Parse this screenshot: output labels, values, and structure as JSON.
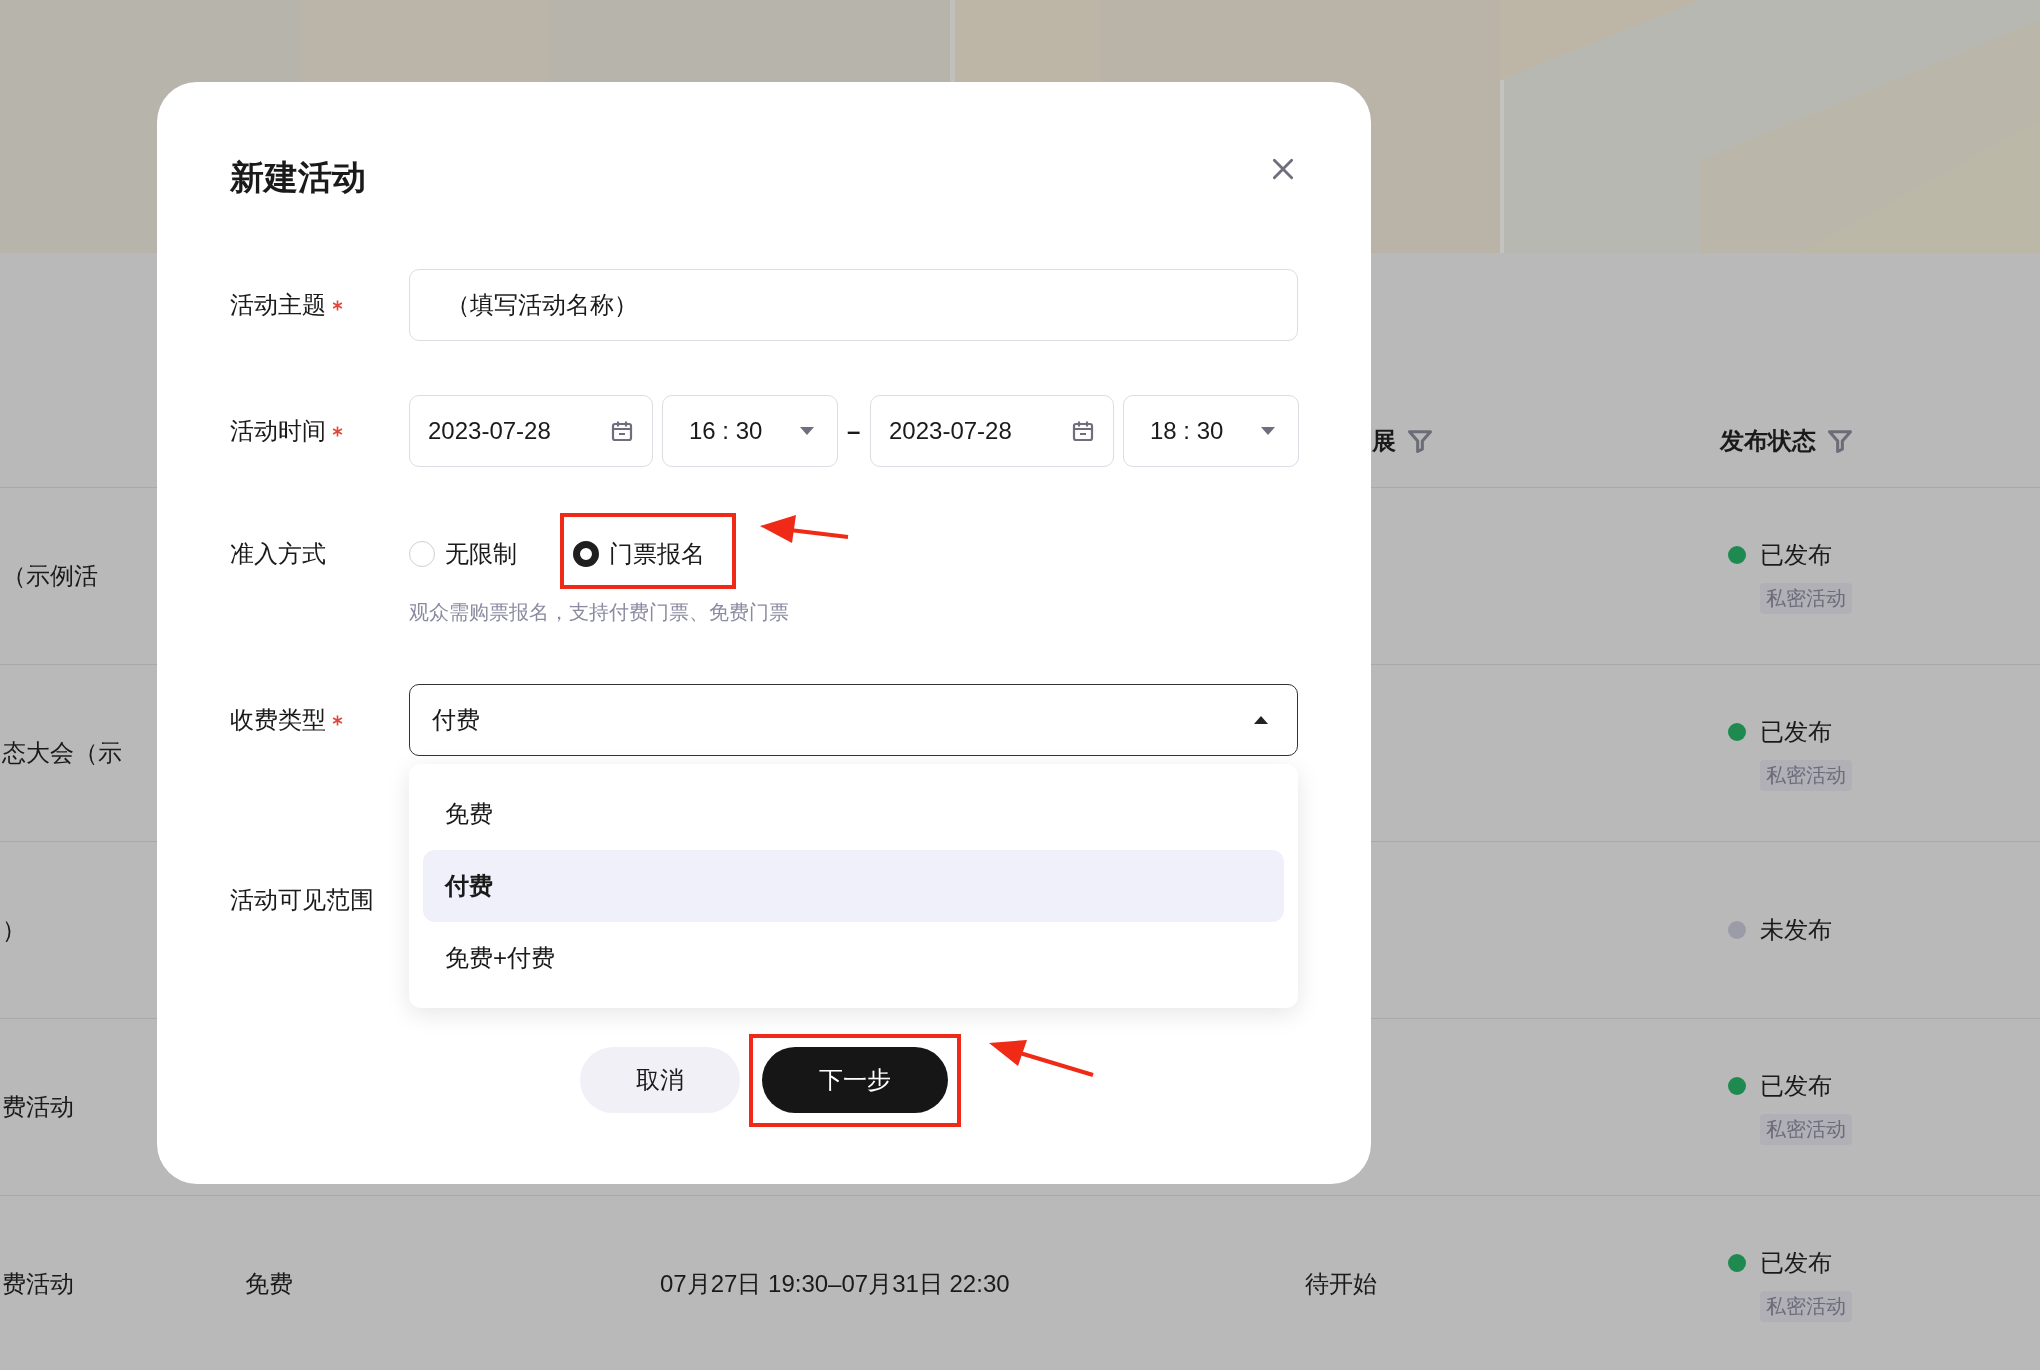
{
  "background_page": {
    "table": {
      "columns": {
        "column_4": "展",
        "publish_status": "发布状态"
      },
      "rows": [
        {
          "column_1": "（示例活",
          "status": {
            "label": "已发布",
            "color": "#1e8a50"
          },
          "tag": "私密活动"
        },
        {
          "column_1": "态大会（示",
          "status": {
            "label": "已发布",
            "color": "#1e8a50"
          },
          "tag": "私密活动"
        },
        {
          "column_1": "）",
          "status": {
            "label": "未发布",
            "color": "#9c9ca8"
          }
        },
        {
          "column_1": "费活动",
          "status": {
            "label": "已发布",
            "color": "#1e8a50"
          },
          "tag": "私密活动"
        },
        {
          "column_1": "费活动",
          "column_2": "免费",
          "column_3": "07月27日 19:30–07月31日 22:30",
          "column_4": "待开始",
          "status": {
            "label": "已发布",
            "color": "#1e8a50"
          },
          "tag": "私密活动"
        }
      ]
    }
  },
  "dialog": {
    "title": "新建活动",
    "fields": [
      {
        "kind": "text",
        "label": "活动主题",
        "required": true,
        "value": "（填写活动名称）"
      },
      {
        "kind": "datetime",
        "label": "活动时间",
        "required": true,
        "start_date": "2023-07-28",
        "start_time": "16 : 30",
        "separator": "–",
        "end_date": "2023-07-28",
        "end_time": "18 : 30"
      },
      {
        "kind": "radio",
        "label": "准入方式",
        "required": false,
        "options": [
          {
            "label": "无限制",
            "selected": false
          },
          {
            "label": "门票报名",
            "selected": true
          }
        ],
        "hint": "观众需购票报名，支持付费门票、免费门票"
      },
      {
        "kind": "select",
        "label": "收费类型",
        "required": true,
        "value": "付费",
        "expanded": true,
        "options": [
          {
            "label": "免费",
            "selected": false
          },
          {
            "label": "付费",
            "selected": true
          },
          {
            "label": "免费+付费",
            "selected": false
          }
        ]
      },
      {
        "kind": "label_only",
        "label": "活动可见范围",
        "required": false
      }
    ],
    "buttons": [
      {
        "label": "取消",
        "kind": "secondary"
      },
      {
        "label": "下一步",
        "kind": "primary"
      }
    ]
  }
}
